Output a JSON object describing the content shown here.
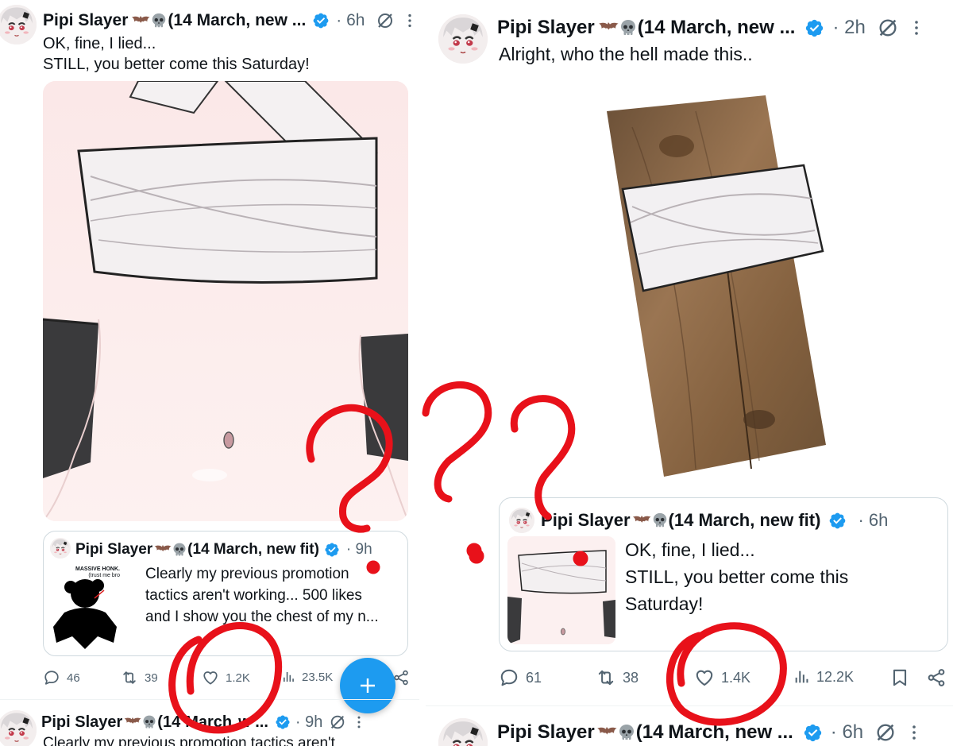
{
  "colors": {
    "accent": "#1d9bf0",
    "muted": "#536471",
    "text": "#0f1419",
    "annotation_red": "#e8111a"
  },
  "left": {
    "tweet": {
      "author": "Pipi Slayer",
      "author_suffix": "(14 March, new ...",
      "time": "· 6h",
      "text_line1": "OK, fine, I lied...",
      "text_line2": "STILL, you better come this Saturday!"
    },
    "quote": {
      "author": "Pipi Slayer",
      "author_suffix": "(14 March, new fit)",
      "time": "· 9h",
      "thumb_caption1": "MASSIVE HONK.",
      "thumb_caption2": "(trust me bro",
      "text_line1": "Clearly my previous promotion",
      "text_line2": "tactics aren't working... 500 likes",
      "text_line3": "and I show you the chest of my n..."
    },
    "actions": {
      "replies": "46",
      "retweets": "39",
      "likes": "1.2K",
      "views": "23.5K"
    },
    "next_tweet": {
      "author": "Pipi Slayer",
      "author_suffix_a": "(14",
      "author_suffix_b": "March",
      "author_suffix_c": "w ...",
      "time": "· 9h",
      "text": "Clearly my previous promotion tactics aren't"
    }
  },
  "right": {
    "tweet": {
      "author": "Pipi Slayer",
      "author_suffix": "(14 March, new ...",
      "time": "· 2h",
      "text": "Alright, who the hell made this.."
    },
    "quote": {
      "author_prefix": "P",
      "author": "ipi Slayer",
      "author_suffix": "(14 March, new fit)",
      "time": "· 6h",
      "text_line1": "OK, fine, I lied...",
      "text_line2": "STILL, you better come this",
      "text_line3": "Saturday!"
    },
    "actions": {
      "replies": "61",
      "retweets": "38",
      "likes": "1.4K",
      "views": "12.2K"
    },
    "next_tweet": {
      "author": "Pipi Slayer",
      "author_suffix_a": "(14",
      "author_suffix_b": "March, new ...",
      "time": "· 6h"
    }
  },
  "icons": {
    "bat": "bat-emoji-icon",
    "skull": "skull-emoji-icon",
    "verified": "verified-badge-icon",
    "grok": "grok-icon",
    "more": "more-vertical-icon",
    "reply": "reply-icon",
    "retweet": "retweet-icon",
    "like": "heart-icon",
    "views": "views-icon",
    "bookmark": "bookmark-icon",
    "share": "share-icon",
    "compose": "compose-plus-icon"
  }
}
